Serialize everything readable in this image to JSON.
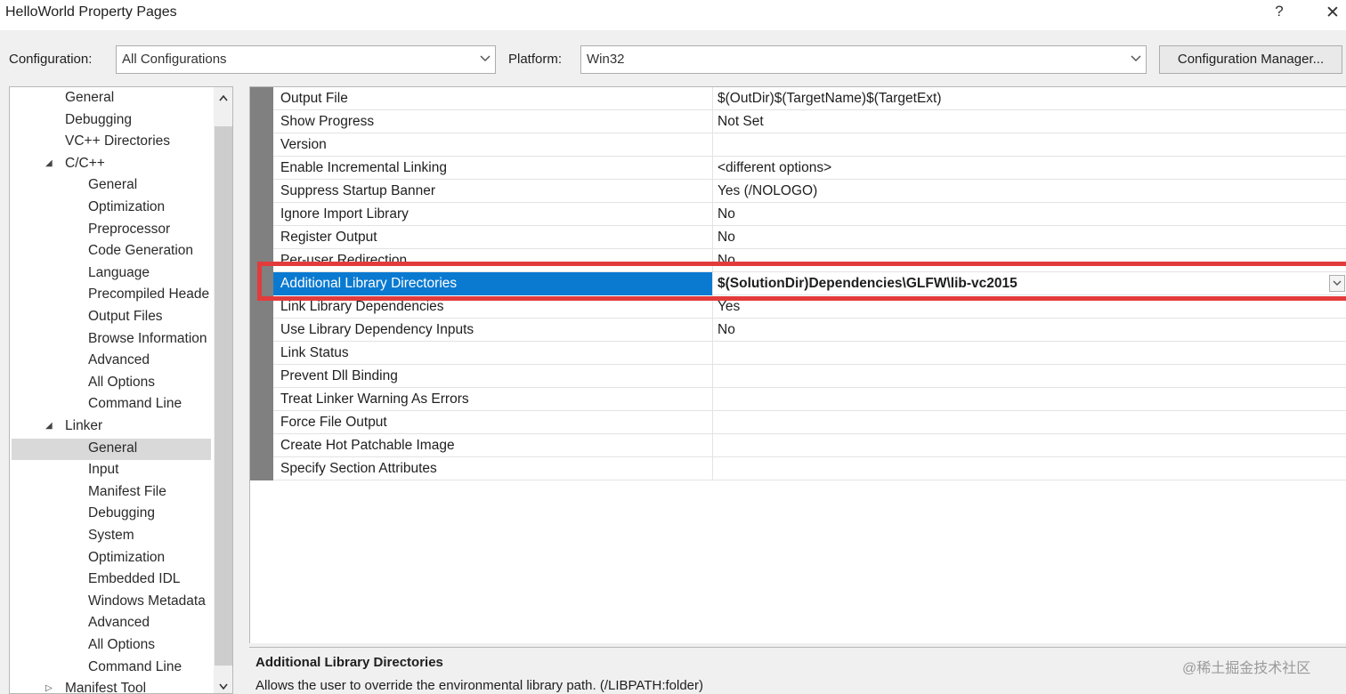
{
  "window": {
    "title": "HelloWorld Property Pages",
    "help": "?",
    "close": "✕"
  },
  "toolbar": {
    "configuration_label": "Configuration:",
    "configuration_value": "All Configurations",
    "platform_label": "Platform:",
    "platform_value": "Win32",
    "config_manager_label": "Configuration Manager..."
  },
  "tree": {
    "items": [
      {
        "label": "General",
        "indent": 2
      },
      {
        "label": "Debugging",
        "indent": 2
      },
      {
        "label": "VC++ Directories",
        "indent": 2
      },
      {
        "label": "C/C++",
        "indent": 1,
        "expanded": true
      },
      {
        "label": "General",
        "indent": 3
      },
      {
        "label": "Optimization",
        "indent": 3
      },
      {
        "label": "Preprocessor",
        "indent": 3
      },
      {
        "label": "Code Generation",
        "indent": 3
      },
      {
        "label": "Language",
        "indent": 3
      },
      {
        "label": "Precompiled Heade",
        "indent": 3
      },
      {
        "label": "Output Files",
        "indent": 3
      },
      {
        "label": "Browse Information",
        "indent": 3
      },
      {
        "label": "Advanced",
        "indent": 3
      },
      {
        "label": "All Options",
        "indent": 3
      },
      {
        "label": "Command Line",
        "indent": 3
      },
      {
        "label": "Linker",
        "indent": 1,
        "expanded": true
      },
      {
        "label": "General",
        "indent": 3,
        "selected": true
      },
      {
        "label": "Input",
        "indent": 3
      },
      {
        "label": "Manifest File",
        "indent": 3
      },
      {
        "label": "Debugging",
        "indent": 3
      },
      {
        "label": "System",
        "indent": 3
      },
      {
        "label": "Optimization",
        "indent": 3
      },
      {
        "label": "Embedded IDL",
        "indent": 3
      },
      {
        "label": "Windows Metadata",
        "indent": 3
      },
      {
        "label": "Advanced",
        "indent": 3
      },
      {
        "label": "All Options",
        "indent": 3
      },
      {
        "label": "Command Line",
        "indent": 3
      },
      {
        "label": "Manifest Tool",
        "indent": 1,
        "expanded": false
      }
    ]
  },
  "properties": [
    {
      "name": "Output File",
      "value": "$(OutDir)$(TargetName)$(TargetExt)"
    },
    {
      "name": "Show Progress",
      "value": "Not Set"
    },
    {
      "name": "Version",
      "value": ""
    },
    {
      "name": "Enable Incremental Linking",
      "value": "<different options>"
    },
    {
      "name": "Suppress Startup Banner",
      "value": "Yes (/NOLOGO)"
    },
    {
      "name": "Ignore Import Library",
      "value": "No"
    },
    {
      "name": "Register Output",
      "value": "No"
    },
    {
      "name": "Per-user Redirection",
      "value": "No"
    },
    {
      "name": "Additional Library Directories",
      "value": "$(SolutionDir)Dependencies\\GLFW\\lib-vc2015",
      "selected": true
    },
    {
      "name": "Link Library Dependencies",
      "value": "Yes"
    },
    {
      "name": "Use Library Dependency Inputs",
      "value": "No"
    },
    {
      "name": "Link Status",
      "value": ""
    },
    {
      "name": "Prevent Dll Binding",
      "value": ""
    },
    {
      "name": "Treat Linker Warning As Errors",
      "value": ""
    },
    {
      "name": "Force File Output",
      "value": ""
    },
    {
      "name": "Create Hot Patchable Image",
      "value": ""
    },
    {
      "name": "Specify Section Attributes",
      "value": ""
    }
  ],
  "description": {
    "title": "Additional Library Directories",
    "text": "Allows the user to override the environmental library path. (/LIBPATH:folder)"
  },
  "watermark": "@稀土掘金技术社区",
  "colors": {
    "selection": "#0a7ad1",
    "highlight_box": "#e33b3b",
    "gutter": "#808080"
  }
}
